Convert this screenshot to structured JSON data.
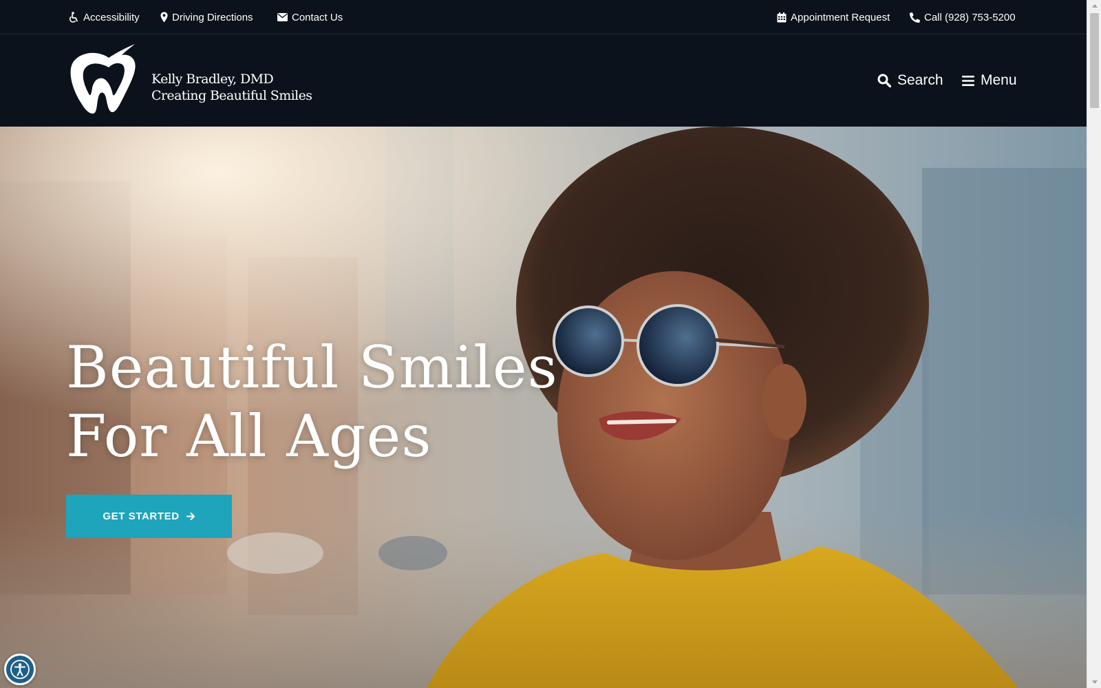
{
  "utility_bar": {
    "accessibility": "Accessibility",
    "directions": "Driving Directions",
    "contact": "Contact Us",
    "appointment": "Appointment Request",
    "phone": "Call (928) 753-5200"
  },
  "header": {
    "logo_line1": "Kelly Bradley, DMD",
    "logo_line2": "Creating Beautiful Smiles",
    "search_label": "Search",
    "menu_label": "Menu"
  },
  "hero": {
    "title_line1": "Beautiful Smiles",
    "title_line2": "For All Ages",
    "cta_label": "GET STARTED"
  },
  "icons": {
    "accessibility": "wheelchair-icon",
    "directions": "map-marker-icon",
    "contact": "envelope-icon",
    "appointment": "calendar-icon",
    "phone": "phone-icon",
    "search": "search-icon",
    "menu": "hamburger-icon",
    "cta": "arrow-right-icon",
    "widget": "accessibility-person-icon"
  },
  "colors": {
    "header_bg": "#0c121b",
    "cta_bg": "#1ea4bb",
    "text": "#ffffff"
  }
}
